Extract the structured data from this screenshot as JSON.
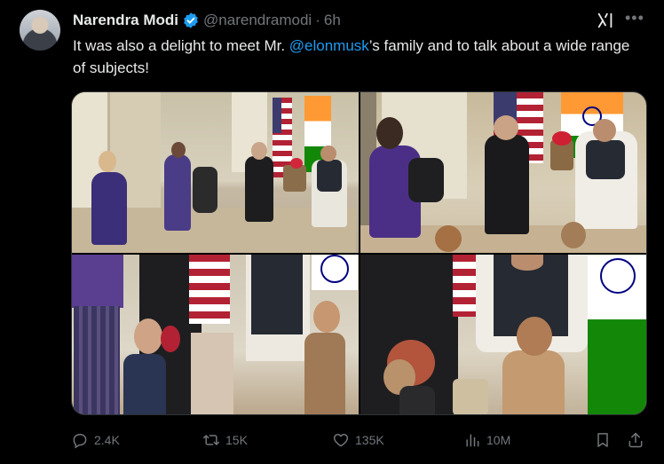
{
  "author": {
    "name": "Narendra Modi",
    "handle": "@narendramodi",
    "separator": "·",
    "time": "6h"
  },
  "tweet": {
    "text_before": "It was also a delight to meet Mr. ",
    "mention": "@elonmusk",
    "text_after": "’s family and to talk about a wide range of subjects!"
  },
  "stats": {
    "replies": "2.4K",
    "reposts": "15K",
    "likes": "135K",
    "views": "10M"
  },
  "icons": {
    "verified": "verified-badge-icon",
    "grok": "grok-icon",
    "more": "more-icon",
    "reply": "reply-icon",
    "repost": "repost-icon",
    "like": "like-icon",
    "views": "views-icon",
    "bookmark": "bookmark-icon",
    "share": "share-icon"
  },
  "colors": {
    "background": "#000000",
    "text": "#e7e9ea",
    "muted": "#71767b",
    "link": "#1d9bf0",
    "verified": "#1d9bf0"
  }
}
